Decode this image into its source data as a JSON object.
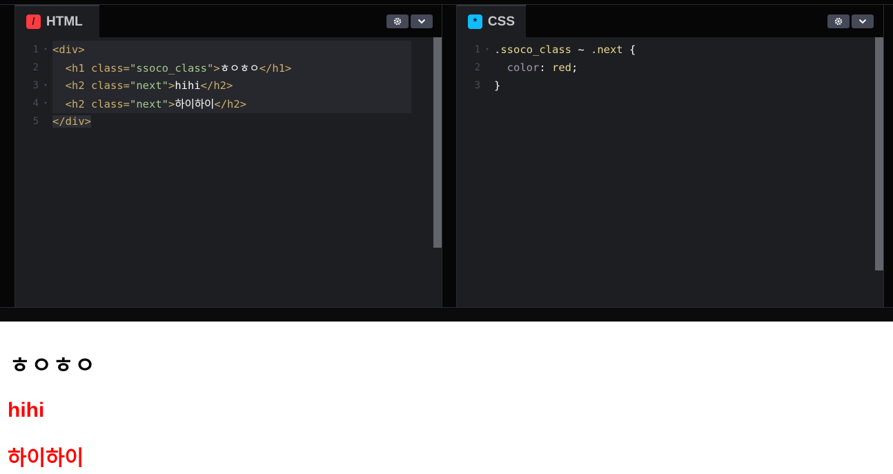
{
  "html_panel": {
    "title": "HTML",
    "icon": "html-slash-icon",
    "lines": [
      {
        "num": "1",
        "fold": "▾"
      },
      {
        "num": "2",
        "fold": ""
      },
      {
        "num": "3",
        "fold": "▾"
      },
      {
        "num": "4",
        "fold": "▾"
      },
      {
        "num": "5",
        "fold": ""
      }
    ],
    "tokens": {
      "div_open": "<div>",
      "h1_open": "<h1",
      "h2_open": "<h2",
      "class_attr": " class=",
      "h1_class": "\"ssoco_class\"",
      "next_class": "\"next\"",
      "gt": ">",
      "h1_text": "ㅎㅇㅎㅇ",
      "h2_text_a": "hihi",
      "h2_text_b": "하이하이",
      "h1_close": "</h1>",
      "h2_close": "</h2>",
      "div_close": "</div>"
    }
  },
  "css_panel": {
    "title": "CSS",
    "icon": "css-asterisk-icon",
    "lines": [
      {
        "num": "1",
        "fold": "▾"
      },
      {
        "num": "2",
        "fold": ""
      },
      {
        "num": "3",
        "fold": ""
      }
    ],
    "tokens": {
      "selector_a": ".ssoco_class",
      "combinator": " ~ ",
      "selector_b": ".next",
      "open_brace": " {",
      "property": "color",
      "colon": ": ",
      "value": "red",
      "semicolon": ";",
      "close_brace": "}"
    }
  },
  "result": {
    "h1": "ㅎㅇㅎㅇ",
    "h2_a": "hihi",
    "h2_b": "하이하이"
  },
  "colors": {
    "html_icon": "#ff3c41",
    "css_icon": "#0ebeff",
    "result_red": "#ff0000"
  }
}
